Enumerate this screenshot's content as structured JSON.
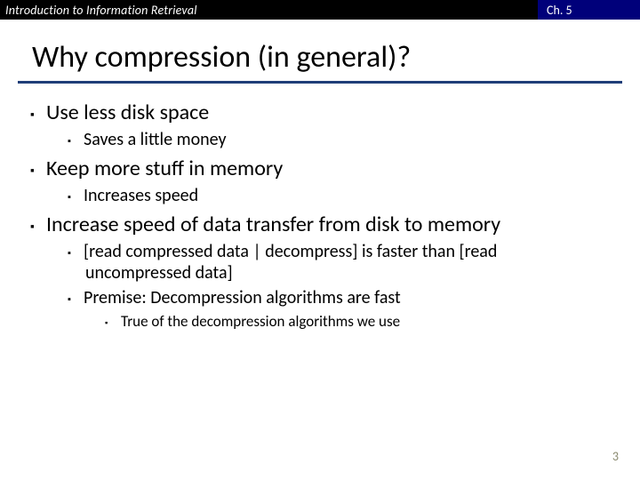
{
  "header": {
    "left": "Introduction to Information Retrieval",
    "right": "Ch. 5"
  },
  "title": "Why compression (in general)?",
  "bullets": {
    "b1": "Use less disk space",
    "b1a": "Saves a little money",
    "b2": "Keep more stuff in memory",
    "b2a": "Increases speed",
    "b3": "Increase speed of data transfer from disk to memory",
    "b3a": "[read compressed data | decompress] is faster than [read uncompressed data]",
    "b3b": "Premise: Decompression algorithms are fast",
    "b3b1": "True of the decompression algorithms we use"
  },
  "pageno": "3"
}
